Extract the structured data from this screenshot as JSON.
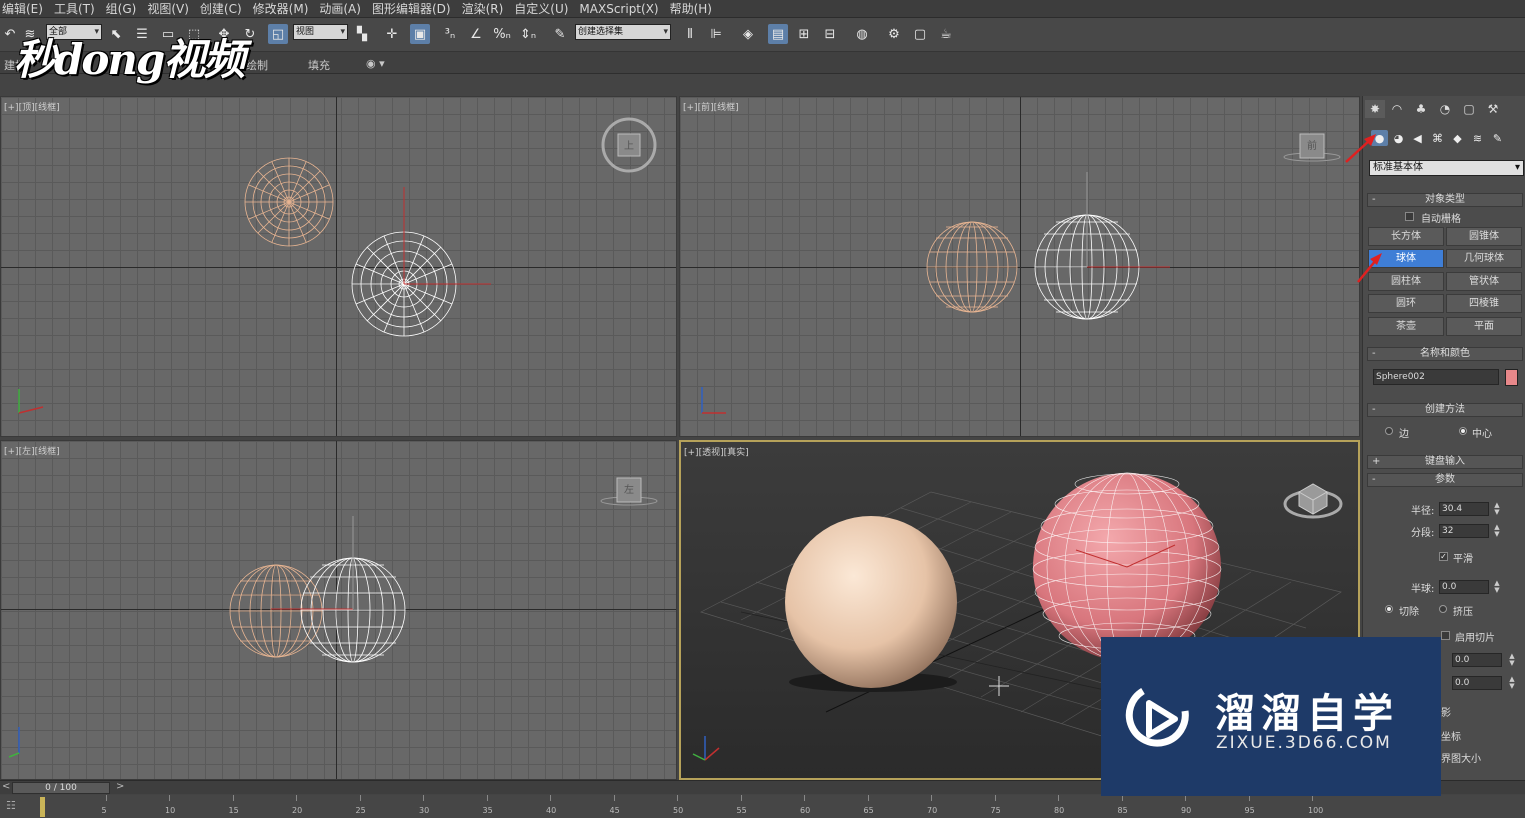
{
  "menubar": {
    "items": [
      "编辑(E)",
      "工具(T)",
      "组(G)",
      "视图(V)",
      "创建(C)",
      "修改器(M)",
      "动画(A)",
      "图形编辑器(D)",
      "渲染(R)",
      "自定义(U)",
      "MAXScript(X)",
      "帮助(H)"
    ]
  },
  "toolbar": {
    "selection_filter": "全部",
    "ref_coord": "视图",
    "named_selection": "创建选择集"
  },
  "ribbon": {
    "fill_label": "填充",
    "left_label": "建模",
    "mid_label": "绘制"
  },
  "logo_top": "秒dong视频",
  "viewports": {
    "top": "[+][顶][线框]",
    "front": "[+][前][线框]",
    "left": "[+][左][线框]",
    "perspective": "[+][透视][真实]"
  },
  "viewcube": {
    "top": "上",
    "front": "前",
    "left": "左"
  },
  "command_panel": {
    "category": "标准基本体",
    "object_type": {
      "title": "对象类型",
      "autogrid": "自动栅格",
      "buttons": [
        "长方体",
        "圆锥体",
        "球体",
        "几何球体",
        "圆柱体",
        "管状体",
        "圆环",
        "四棱锥",
        "茶壶",
        "平面"
      ],
      "active": "球体"
    },
    "name_color": {
      "title": "名称和颜色",
      "name": "Sphere002",
      "color": "#e8888a"
    },
    "creation_method": {
      "title": "创建方法",
      "edge": "边",
      "center": "中心"
    },
    "keyboard_entry": "键盘输入",
    "parameters": {
      "title": "参数",
      "radius_label": "半径:",
      "radius": "30.4",
      "segments_label": "分段:",
      "segments": "32",
      "smooth": "平滑",
      "hemisphere_label": "半球:",
      "hemisphere": "0.0",
      "chop": "切除",
      "squash": "挤压",
      "enable_slice": "启用切片",
      "slice_from": "0.0",
      "slice_to": "0.0",
      "hidden_1": "影",
      "hidden_2": "坐标",
      "hidden_3": "界图大小"
    }
  },
  "timeline": {
    "slider": "0 / 100",
    "ticks": [
      "5",
      "10",
      "15",
      "20",
      "25",
      "30",
      "35",
      "40",
      "45",
      "50",
      "55",
      "60",
      "65",
      "70",
      "75",
      "80",
      "85",
      "90",
      "95",
      "100"
    ]
  },
  "watermark": {
    "title": "溜溜自学",
    "url": "ZIXUE.3D66.COM"
  },
  "colors": {
    "accent": "#3f7ed6",
    "sphere_peach": "#e8b592",
    "sphere_pink": "#e27f85",
    "wire_white": "#ffffff",
    "watermark_bg": "#1e3a68"
  }
}
